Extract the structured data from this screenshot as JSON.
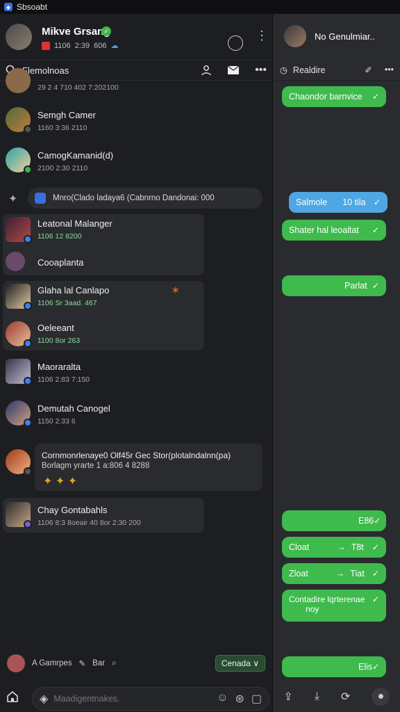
{
  "statusbar": {
    "app_name": "Sbsoabt"
  },
  "header": {
    "title": "Mikve Grsang",
    "sub1": "1106",
    "sub2": "2:39",
    "sub3": "606"
  },
  "search": {
    "label": "Flemolnoas"
  },
  "chats": [
    {
      "name": "",
      "meta": "29  2 4 710   402 7:202100"
    },
    {
      "name": "Semgh Camer",
      "meta": "1160   3:36 2110"
    },
    {
      "name": "CamogKamanid(d)",
      "meta": "2100   2:30 2110"
    },
    {
      "name": "Leatonal Malanger",
      "meta": "1106   12 8200"
    },
    {
      "name": "Cooaplanta",
      "meta": ""
    },
    {
      "name": "Glaha lal Canlapo",
      "meta": "1106   Sr 3aad. 467"
    },
    {
      "name": "Oeleeant",
      "meta": "1100   8or 263"
    },
    {
      "name": "Maoraralta",
      "meta": "1106   2:83 7:150"
    },
    {
      "name": "Demutah Canogel",
      "meta": "1150   2:33 6"
    },
    {
      "name": "Cornmonrlenaye0 Olf45r Gec Stor(plotalndalnn(pa)",
      "meta": "Borlagm yrarte 1 a:806 4 8288"
    },
    {
      "name": "Chay Gontabahls",
      "meta": "1106   8:3 8oeair 40 8or 2:30 200"
    }
  ],
  "pill_text": "Mnro(Clado ladaya6 (Cabnrno Dandonai: 000",
  "composer": {
    "label1": "A Gamrpes",
    "label2": "Bar",
    "extension_button": "Cenada"
  },
  "input": {
    "placeholder": "Maadigentnakes."
  },
  "right": {
    "header_title": "No Genulmiar..",
    "search_label": "Realdire",
    "bubbles": [
      {
        "text": "Chaondor barnvice"
      },
      {
        "text": "Salmole",
        "aux": "10 tila"
      },
      {
        "text": "Shater hal leoaltat"
      },
      {
        "text": "Parlat"
      },
      {
        "text": "E86"
      },
      {
        "text": "Cloat",
        "aux": "T8t"
      },
      {
        "text": "Zloat",
        "aux": "Tiat"
      },
      {
        "text": "Contadire lqrterenae",
        "aux": "noy"
      },
      {
        "text": "Elis"
      }
    ]
  }
}
